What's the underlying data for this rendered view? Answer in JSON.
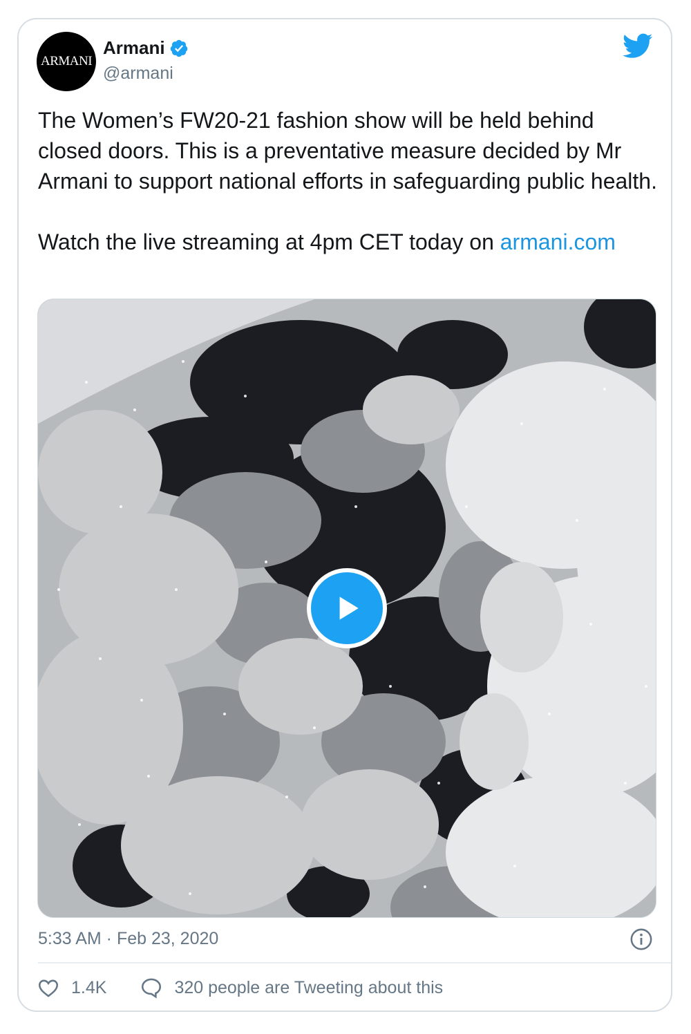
{
  "author": {
    "avatar_text": "ARMANI",
    "name": "Armani",
    "handle": "@armani",
    "verified": true
  },
  "tweet": {
    "text": "The Women’s FW20-21 fashion show will be held behind closed doors. This is a preventative measure decided by Mr Armani to support national efforts in safeguarding public health.\n\nWatch the live streaming at 4pm CET today on ",
    "link_text": "armani.com"
  },
  "media": {
    "type": "video",
    "play_icon": "play-icon"
  },
  "meta": {
    "timestamp": "5:33 AM · Feb 23, 2020"
  },
  "actions": {
    "like_count": "1.4K",
    "conversation_text": "320 people are Tweeting about this"
  },
  "colors": {
    "accent": "#1da1f2",
    "link": "#1b95e0",
    "text": "#14171a",
    "secondary": "#657786"
  },
  "icons": [
    "verified-badge-icon",
    "twitter-bird-icon",
    "play-icon",
    "info-icon",
    "heart-icon",
    "speech-bubble-icon"
  ]
}
